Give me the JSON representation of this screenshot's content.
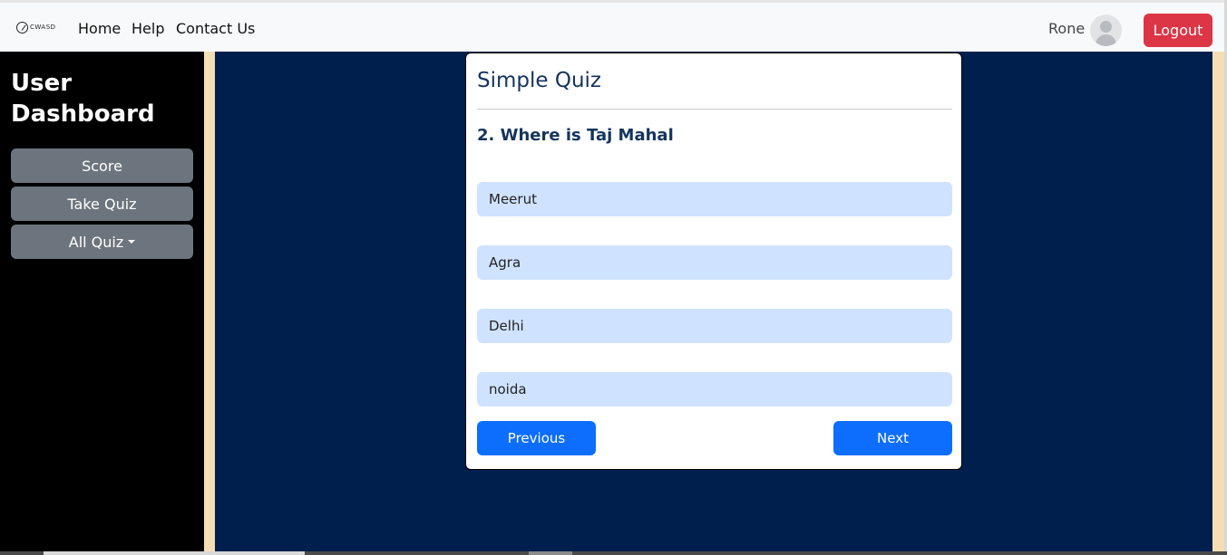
{
  "navbar": {
    "brand_text": "CWASD",
    "links": [
      "Home",
      "Help",
      "Contact Us"
    ],
    "username": "Rone",
    "logout_label": "Logout"
  },
  "sidebar": {
    "title": "User Dashboard",
    "buttons": [
      "Score",
      "Take Quiz",
      "All Quiz"
    ]
  },
  "quiz": {
    "title": "Simple Quiz",
    "question": "2. Where is Taj Mahal",
    "options": [
      "Meerut",
      "Agra",
      "Delhi",
      "noida"
    ],
    "previous_label": "Previous",
    "next_label": "Next"
  },
  "colors": {
    "main_background": "#001f4d",
    "sidebar_background": "#000000",
    "side_border": "#f5deb3",
    "option_background": "#cfe2ff",
    "primary_button": "#0d6efd",
    "secondary_button": "#6c757d",
    "danger_button": "#dc3545"
  },
  "icons": {
    "brand": "logo-icon",
    "avatar": "user-avatar-icon",
    "dropdown": "caret-down-icon"
  }
}
